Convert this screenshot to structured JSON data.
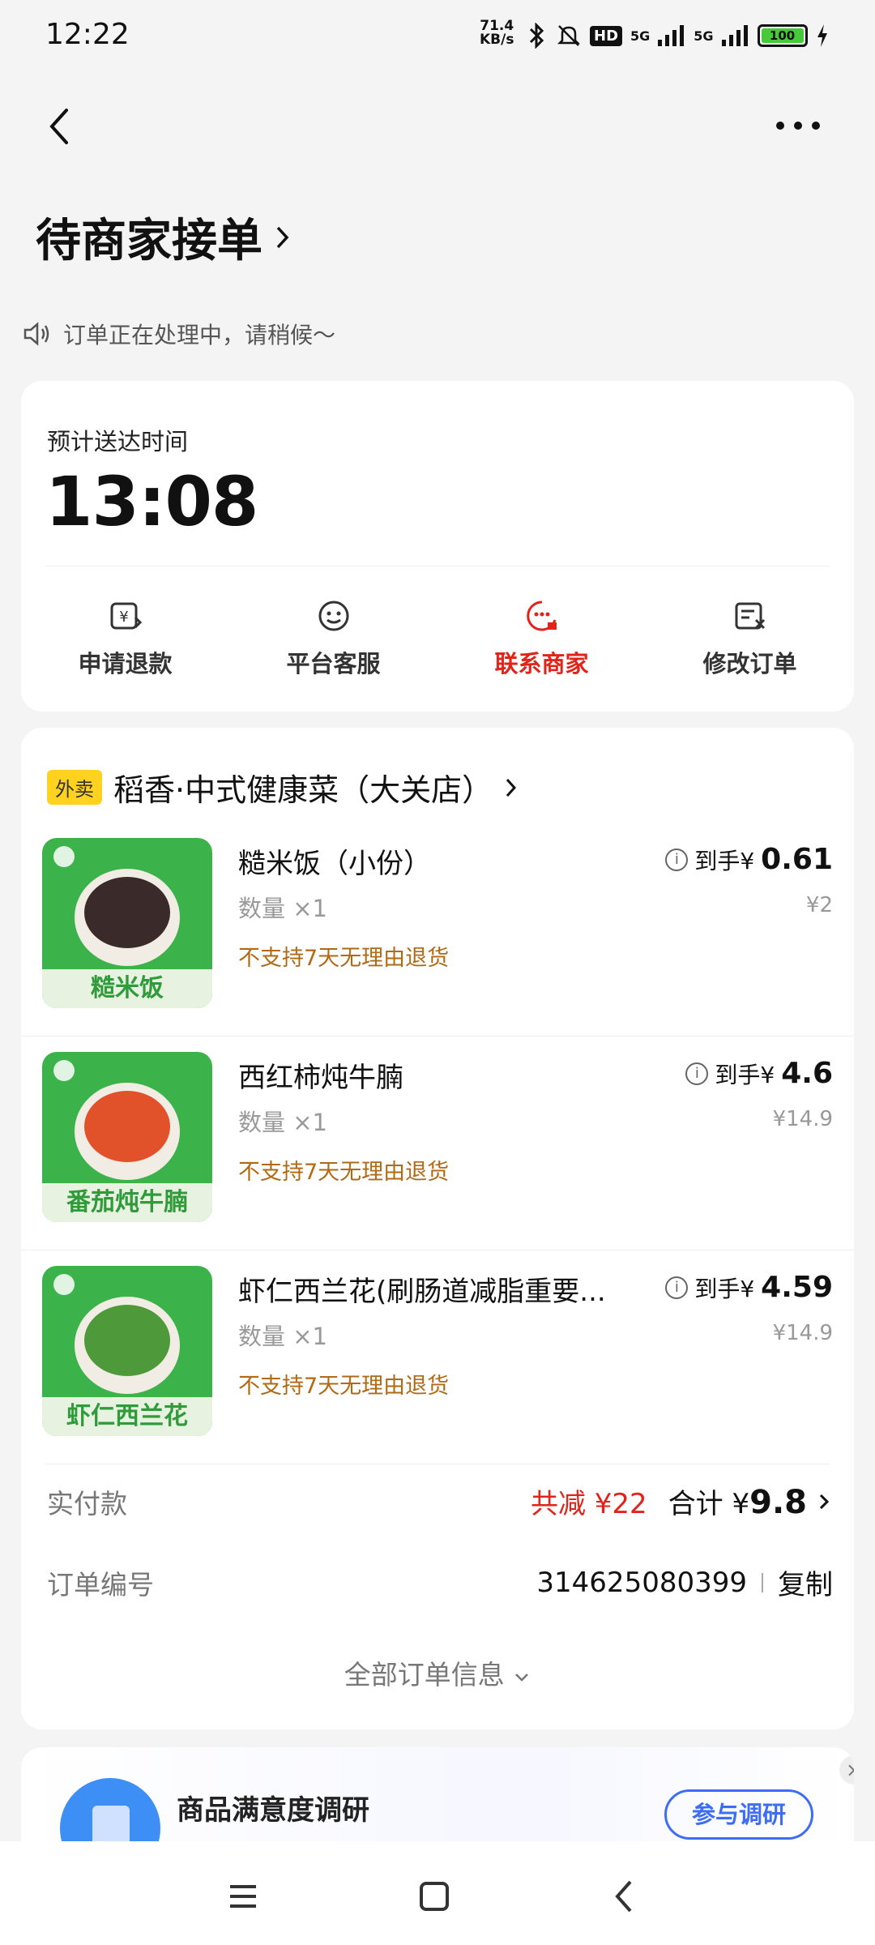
{
  "status_bar": {
    "time": "12:22",
    "net_speed_value": "71.4",
    "net_speed_unit": "KB/s",
    "hd": "HD",
    "signal1": "5G",
    "signal2": "5G",
    "battery": "100"
  },
  "header": {
    "title": "待商家接单",
    "notice": "订单正在处理中，请稍候～"
  },
  "eta": {
    "label": "预计送达时间",
    "time": "13:08"
  },
  "actions": [
    {
      "label": "申请退款",
      "icon": "refund-icon"
    },
    {
      "label": "平台客服",
      "icon": "customer-service-icon"
    },
    {
      "label": "联系商家",
      "icon": "contact-merchant-icon",
      "color": "#e2231a"
    },
    {
      "label": "修改订单",
      "icon": "edit-order-icon"
    }
  ],
  "shop": {
    "tag": "外卖",
    "name": "稻香·中式健康菜（大关店）"
  },
  "items": [
    {
      "name": "糙米饭（小份）",
      "qty": "数量 ×1",
      "note": "不支持7天无理由退货",
      "price_prefix": "到手¥",
      "price": "0.61",
      "original": "¥2",
      "caption": "糙米饭",
      "food_color": "#3a2b2a"
    },
    {
      "name": "西红柿炖牛腩",
      "qty": "数量 ×1",
      "note": "不支持7天无理由退货",
      "price_prefix": "到手¥",
      "price": "4.6",
      "original": "¥14.9",
      "caption": "番茄炖牛腩",
      "food_color": "#e2522a"
    },
    {
      "name": "虾仁西兰花(刷肠道减脂重要...",
      "qty": "数量 ×1",
      "note": "不支持7天无理由退货",
      "price_prefix": "到手¥",
      "price": "4.59",
      "original": "¥14.9",
      "caption": "虾仁西兰花",
      "food_color": "#4e9a3a"
    }
  ],
  "payment": {
    "label": "实付款",
    "reduction": "共减 ¥22",
    "total_prefix": "合计 ¥",
    "total": "9.8"
  },
  "order_id": {
    "label": "订单编号",
    "value": "314625080399",
    "copy": "复制"
  },
  "all_info": "全部订单信息",
  "survey": {
    "title": "商品满意度调研",
    "button": "参与调研"
  }
}
